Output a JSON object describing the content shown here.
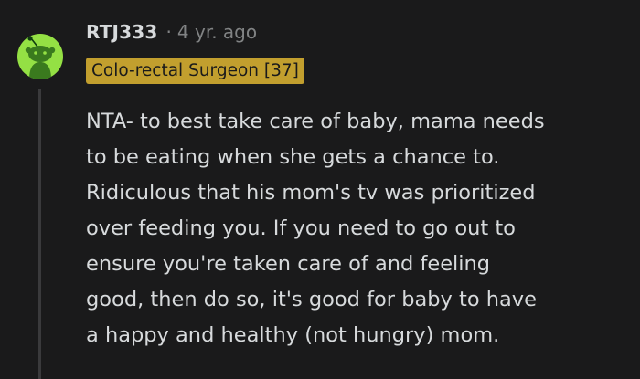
{
  "comment": {
    "username": "RTJ333",
    "separator": "·",
    "age": "4 yr. ago",
    "flair": "Colo-rectal Surgeon [37]",
    "body_lines": [
      "NTA- to best take care of baby, mama needs",
      "to be eating when she gets a chance to.",
      "Ridiculous that his mom's tv was prioritized",
      "over feeding you. If you need to go out to",
      "ensure you're taken care of and feeling",
      "good, then do so, it's good for baby to have",
      "a happy and healthy (not hungry) mom."
    ],
    "avatar_icon": "snoo-avatar-icon"
  },
  "colors": {
    "background": "#1a1a1b",
    "text": "#d7dadc",
    "muted": "#818384",
    "avatar_bg": "#94e044",
    "flair_bg": "#c29f2e",
    "thread_line": "#3a3a3c"
  }
}
